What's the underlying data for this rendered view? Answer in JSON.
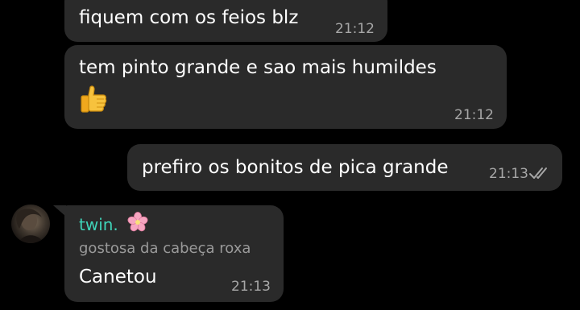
{
  "messages": [
    {
      "direction": "incoming",
      "text": "fiquem com os feios blz",
      "time": "21:12"
    },
    {
      "direction": "incoming",
      "text": "tem pinto grande e sao mais humildes",
      "emoji": "thumbs-up-icon",
      "time": "21:12"
    },
    {
      "direction": "outgoing",
      "text": "prefiro os bonitos de pica grande",
      "time": "21:13",
      "status": "double-check-icon"
    },
    {
      "direction": "incoming",
      "sender": "twin.",
      "sender_emoji": "cherry-blossom-icon",
      "sender_subtitle": "gostosa da cabeça roxa",
      "text": "Canetou",
      "time": "21:13"
    }
  ],
  "colors": {
    "background": "#000000",
    "bubble": "#2a2a2a",
    "sender_name": "#3fd3b8",
    "timestamp": "#a7a7a7"
  }
}
